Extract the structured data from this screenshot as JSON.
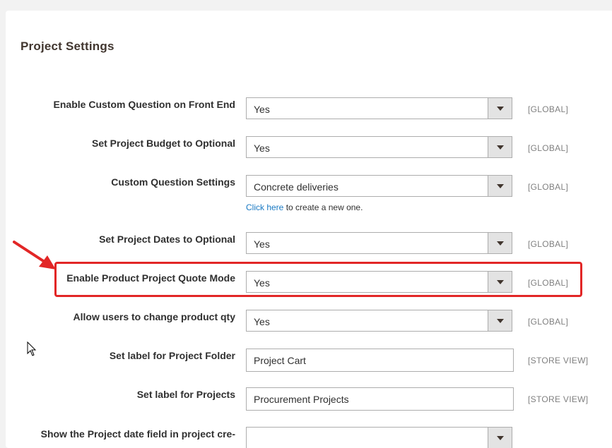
{
  "section": {
    "title": "Project Settings"
  },
  "fields": [
    {
      "label": "Enable Custom Question on Front End",
      "value": "Yes",
      "scope": "[GLOBAL]"
    },
    {
      "label": "Set Project Budget to Optional",
      "value": "Yes",
      "scope": "[GLOBAL]"
    },
    {
      "label": "Custom Question Settings",
      "value": "Concrete deliveries",
      "scope": "[GLOBAL]",
      "note_link": "Click here",
      "note_text": " to create a new one."
    },
    {
      "label": "Set Project Dates to Optional",
      "value": "Yes",
      "scope": "[GLOBAL]"
    },
    {
      "label": "Enable Product Project Quote Mode",
      "value": "Yes",
      "scope": "[GLOBAL]"
    },
    {
      "label": "Allow users to change product qty",
      "value": "Yes",
      "scope": "[GLOBAL]"
    },
    {
      "label": "Set label for Project Folder",
      "value": "Project Cart",
      "scope": "[STORE VIEW]"
    },
    {
      "label": "Set label for Projects",
      "value": "Procurement Projects",
      "scope": "[STORE VIEW]"
    },
    {
      "label": "Show the Project date field in project cre-",
      "value": "",
      "scope": ""
    }
  ],
  "colors": {
    "highlight": "#e22626",
    "link": "#1979c3",
    "scope_text": "#808080"
  },
  "icons": {
    "dropdown": "chevron-down-icon",
    "annotation": "red-arrow-icon",
    "pointer": "mouse-cursor-icon"
  }
}
